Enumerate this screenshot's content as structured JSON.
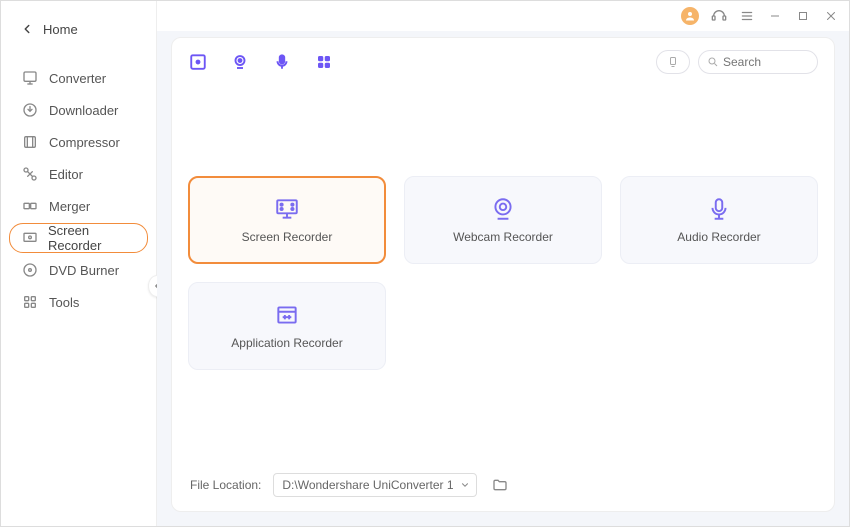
{
  "sidebar": {
    "title": "Home",
    "items": [
      {
        "label": "Converter",
        "active": false
      },
      {
        "label": "Downloader",
        "active": false
      },
      {
        "label": "Compressor",
        "active": false
      },
      {
        "label": "Editor",
        "active": false
      },
      {
        "label": "Merger",
        "active": false
      },
      {
        "label": "Screen Recorder",
        "active": true
      },
      {
        "label": "DVD Burner",
        "active": false
      },
      {
        "label": "Tools",
        "active": false
      }
    ]
  },
  "search": {
    "placeholder": "Search"
  },
  "cards": [
    {
      "label": "Screen Recorder",
      "active": true
    },
    {
      "label": "Webcam Recorder",
      "active": false
    },
    {
      "label": "Audio Recorder",
      "active": false
    },
    {
      "label": "Application Recorder",
      "active": false
    }
  ],
  "footer": {
    "label": "File Location:",
    "path": "D:\\Wondershare UniConverter 1"
  },
  "colors": {
    "accent": "#f28c3b",
    "primary": "#6d56f5"
  }
}
